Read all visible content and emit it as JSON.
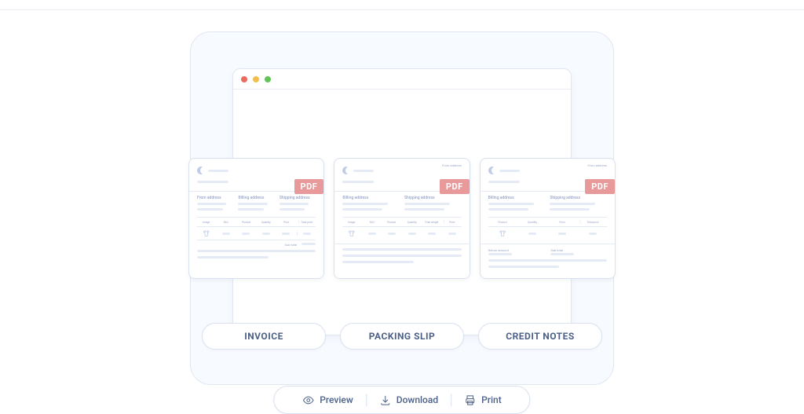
{
  "badge": "PDF",
  "docs": {
    "invoice": {
      "label": "INVOICE",
      "sections": {
        "a": "From address",
        "b": "Billing address",
        "c": "Shipping address"
      },
      "columns": [
        "Image",
        "SKU",
        "Product",
        "Quantity",
        "Price",
        "Total price"
      ],
      "subtotal": "Sub total"
    },
    "packing": {
      "label": "PACKING SLIP",
      "top_right": "From address",
      "sections": {
        "a": "Billing address",
        "b": "Shipping address"
      },
      "columns": [
        "Image",
        "SKU",
        "Product",
        "Quantity",
        "Total weight",
        "Price"
      ]
    },
    "credit": {
      "label": "CREDIT NOTES",
      "top_right": "From address",
      "sections": {
        "a": "Billing address",
        "b": "Shipping address"
      },
      "columns": [
        "Product",
        "Quantity",
        "Price",
        "Total price"
      ],
      "footer": {
        "a": "Return amount",
        "b": "Sub total"
      }
    }
  },
  "actions": {
    "preview": "Preview",
    "download": "Download",
    "print": "Print"
  }
}
